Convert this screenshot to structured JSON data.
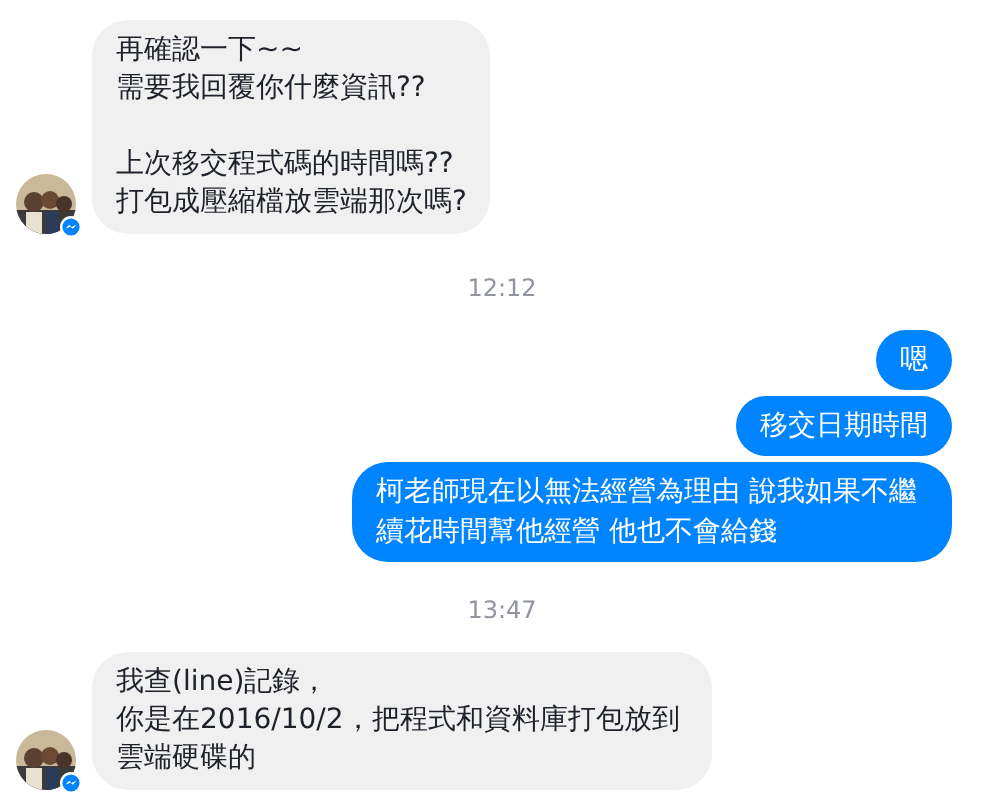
{
  "messages": [
    {
      "kind": "received",
      "avatar": true,
      "paragraphs": [
        [
          "再確認一下~~",
          "需要我回覆你什麼資訊??"
        ],
        [
          "上次移交程式碼的時間嗎??",
          "打包成壓縮檔放雲端那次嗎?"
        ]
      ]
    },
    {
      "kind": "timestamp",
      "text": "12:12"
    },
    {
      "kind": "sent",
      "paragraphs": [
        [
          "嗯"
        ]
      ]
    },
    {
      "kind": "sent",
      "paragraphs": [
        [
          "移交日期時間"
        ]
      ]
    },
    {
      "kind": "sent",
      "paragraphs": [
        [
          "柯老師現在以無法經營為理由 說我如果不繼續花時間幫他經營 他也不會給錢"
        ]
      ]
    },
    {
      "kind": "timestamp",
      "text": "13:47"
    },
    {
      "kind": "received",
      "avatar": true,
      "paragraphs": [
        [
          "我查(line)記錄，",
          "你是在2016/10/2，把程式和資料庫打包放到雲端硬碟的"
        ]
      ]
    }
  ]
}
